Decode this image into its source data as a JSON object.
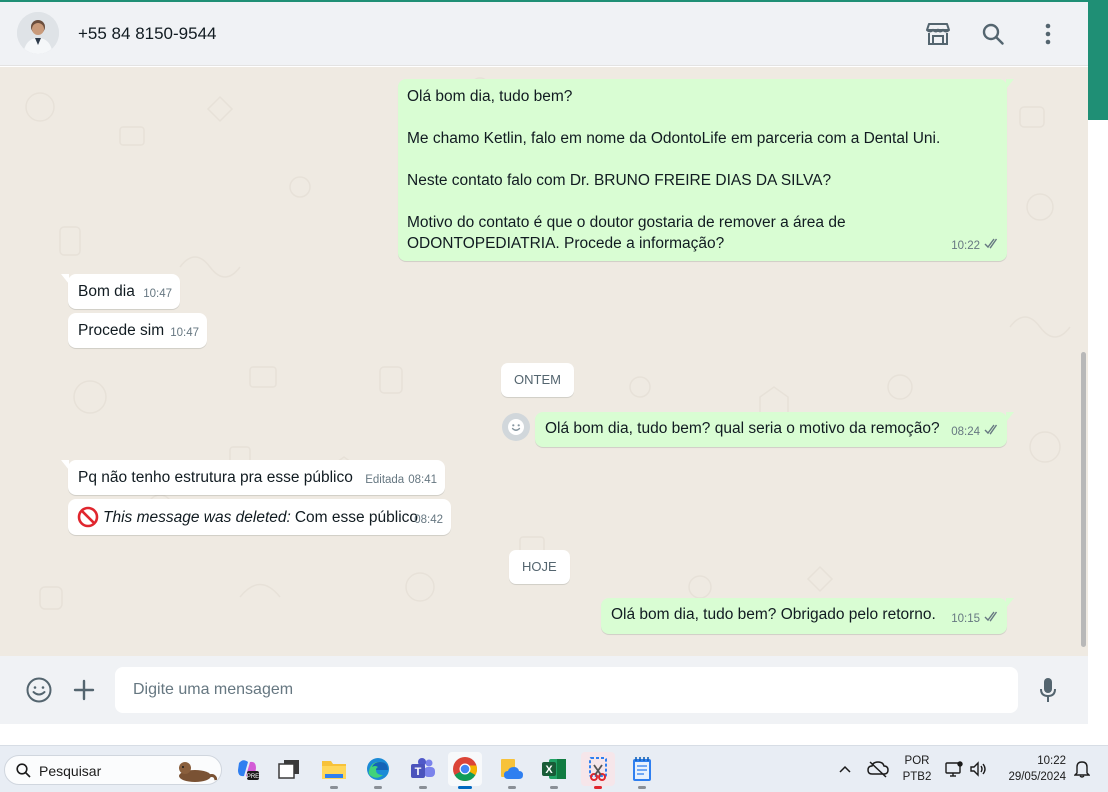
{
  "header": {
    "contact_name": "+55 84 8150-9544",
    "icons": [
      "shop-icon",
      "search-icon",
      "more-vertical-icon"
    ]
  },
  "chat": {
    "messages": [
      {
        "direction": "out",
        "paragraphs": [
          "Olá bom dia, tudo bem?",
          "Me chamo Ketlin, falo em nome da OdontoLife em parceria com a Dental Uni.",
          "Neste contato falo com Dr. BRUNO FREIRE DIAS DA SILVA?",
          "Motivo do contato é que o doutor gostaria de remover a área de ODONTOPEDIATRIA. Procede a informação?"
        ],
        "time": "10:22",
        "status": "read"
      },
      {
        "direction": "in",
        "text": "Bom dia",
        "time": "10:47"
      },
      {
        "direction": "in",
        "text": "Procede sim",
        "time": "10:47"
      },
      {
        "direction": "out",
        "text": "Olá bom dia, tudo bem? qual seria o motivo da remoção?",
        "time": "08:24",
        "status": "read"
      },
      {
        "direction": "in",
        "text": "Pq não tenho estrutura pra esse público",
        "edited_label": "Editada",
        "time": "08:41"
      },
      {
        "direction": "in",
        "deleted_label": "This message was deleted:",
        "text": "Com esse público",
        "time": "08:42"
      },
      {
        "direction": "out",
        "text": "Olá bom dia, tudo bem? Obrigado pelo retorno.",
        "time": "10:15",
        "status": "read"
      }
    ],
    "date_dividers": [
      "ONTEM",
      "HOJE"
    ]
  },
  "composer": {
    "placeholder": "Digite uma mensagem",
    "icons": [
      "emoji-icon",
      "plus-icon",
      "microphone-icon"
    ]
  },
  "taskbar": {
    "search_placeholder": "Pesquisar",
    "language": "POR",
    "layout": "PTB2",
    "time": "10:22",
    "date": "29/05/2024"
  },
  "colors": {
    "outgoing_bubble": "#d9fdd3",
    "incoming_bubble": "#ffffff",
    "chat_background": "#efeae2",
    "read_tick": "#667781",
    "accent": "#1f8f75"
  }
}
